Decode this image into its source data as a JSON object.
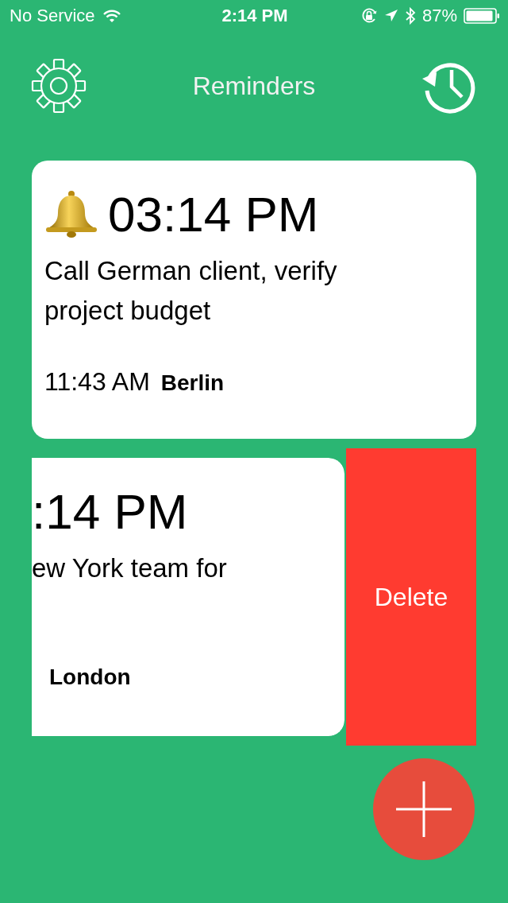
{
  "status_bar": {
    "carrier": "No Service",
    "time": "2:14 PM",
    "battery": "87%"
  },
  "header": {
    "title": "Reminders"
  },
  "reminders": [
    {
      "alarm": true,
      "time": "03:14 PM",
      "text": "Call German client, verify project budget",
      "local_time": "11:43 AM",
      "city": "Berlin",
      "swiped": false
    },
    {
      "time": ":14 PM",
      "text": "ew York team for",
      "city": "London",
      "swiped": true,
      "action": "Delete"
    }
  ]
}
